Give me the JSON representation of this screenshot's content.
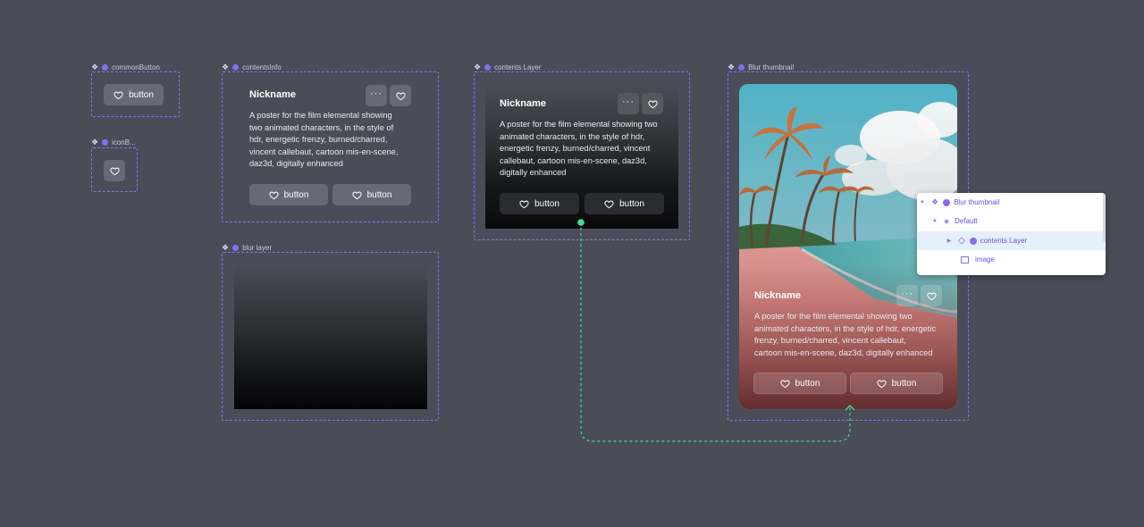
{
  "frames": {
    "common_button": {
      "label": "commonButton",
      "button_label": "button"
    },
    "icon_button": {
      "label": "iconB..."
    },
    "contents_info": {
      "label": "contentsInfo",
      "nickname": "Nickname",
      "description_lines": [
        "A poster for the film elemental showing",
        "two animated characters, in the style of",
        "hdr, energetic frenzy, burned/charred,",
        "vincent callebaut, cartoon mis-en-scene,",
        "daz3d, digitally enhanced"
      ],
      "more_label": "···",
      "buttons": [
        "button",
        "button"
      ]
    },
    "blur_layer": {
      "label": "blur layer"
    },
    "contents_layer": {
      "label": "contents Layer",
      "nickname": "Nickname",
      "description_lines": [
        "A poster for the film elemental showing two",
        "animated characters, in the style of hdr,",
        "energetic frenzy, burned/charred, vincent",
        "callebaut, cartoon mis-en-scene, daz3d,",
        "digitally enhanced"
      ],
      "more_label": "···",
      "buttons": [
        "button",
        "button"
      ]
    },
    "blur_thumbnail": {
      "label": "Blur thumbnail",
      "nickname": "Nickname",
      "description_lines": [
        "A poster for the film elemental showing two",
        "animated characters, in the style of hdr, energetic",
        "frenzy, burned/charred, vincent callebaut,",
        "cartoon mis-en-scene, daz3d, digitally enhanced"
      ],
      "more_label": "···",
      "buttons": [
        "button",
        "button"
      ]
    }
  },
  "layers_panel": {
    "rows": [
      "Blur thumbnail",
      "Default",
      "contents Layer",
      "image"
    ]
  },
  "colors": {
    "canvas": "#4a4d57",
    "frame_dash": "#8a6cf0",
    "connector": "#3ddc97",
    "panel_selected": "#e4f0fb"
  }
}
